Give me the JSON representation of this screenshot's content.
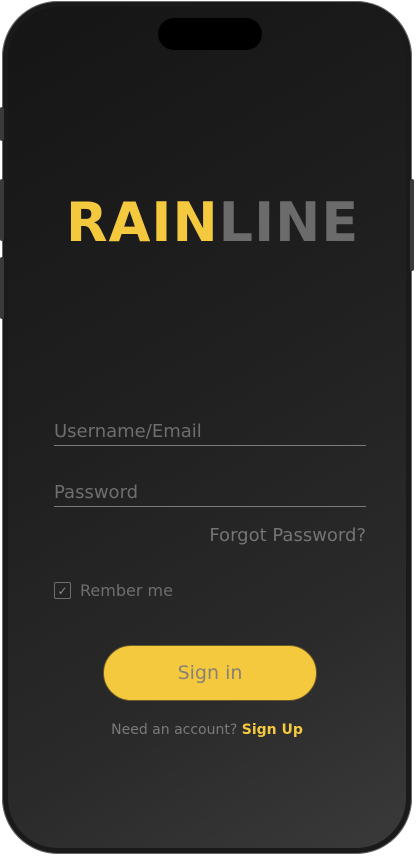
{
  "logo": {
    "part1": "RAIN",
    "part2": "LINE"
  },
  "form": {
    "username_placeholder": "Username/Email",
    "password_placeholder": "Password",
    "forgot_label": "Forgot Password?",
    "remember_label": "Rember me",
    "remember_checked": true,
    "signin_label": "Sign in"
  },
  "footer": {
    "prompt": "Need an account?",
    "signup_label": "Sign Up"
  },
  "colors": {
    "accent": "#f5c93e",
    "logo_secondary": "#6b6b6b",
    "background_dark": "#151515"
  }
}
